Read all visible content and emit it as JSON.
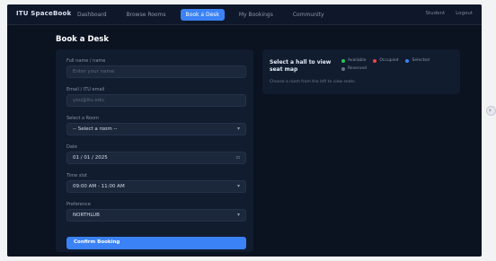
{
  "app": {
    "brand": "ITU SpaceBook"
  },
  "nav": {
    "tabs": [
      {
        "label": "Dashboard"
      },
      {
        "label": "Browse Rooms"
      },
      {
        "label": "Book a Desk"
      },
      {
        "label": "My Bookings"
      },
      {
        "label": "Community"
      }
    ],
    "active_index": 2,
    "right": {
      "user": "Student",
      "logout": "Logout"
    }
  },
  "page": {
    "title": "Book a Desk"
  },
  "form": {
    "fields": [
      {
        "label": "Full name / name",
        "value": "",
        "placeholder": "Enter your name"
      },
      {
        "label": "Email / ITU email",
        "value": "",
        "placeholder": "you@itu.edu"
      },
      {
        "label": "Select a Room",
        "value": "-- Select a room --",
        "placeholder": ""
      },
      {
        "label": "Date",
        "value": "01 / 01 / 2025",
        "placeholder": ""
      },
      {
        "label": "Time slot",
        "value": "09:00 AM - 11:00 AM",
        "placeholder": ""
      },
      {
        "label": "Preference",
        "value": "NORTHLUB",
        "placeholder": ""
      }
    ],
    "submit_label": "Confirm Booking"
  },
  "panel": {
    "title": "Select a hall to view seat map",
    "subtitle": "Choose a room from the left to view seats.",
    "legend": [
      {
        "label": "Available",
        "color": "#22c55e"
      },
      {
        "label": "Occupied",
        "color": "#ef4444"
      },
      {
        "label": "Selected",
        "color": "#3b82f6"
      },
      {
        "label": "Reserved",
        "color": "#64748b"
      }
    ]
  },
  "edge_control": {
    "icon": "chevron-right-icon",
    "glyph": "›"
  }
}
